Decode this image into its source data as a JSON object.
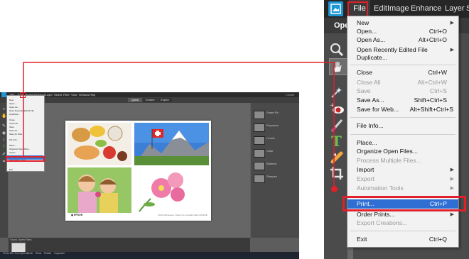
{
  "zoom": {
    "menubar": [
      "File",
      "Edit",
      "Image",
      "Enhance",
      "Layer",
      "S"
    ],
    "open_tab": "Ope",
    "file_menu": {
      "items": [
        {
          "label": "New",
          "shortcut": "",
          "submenu": true,
          "disabled": false
        },
        {
          "label": "Open...",
          "shortcut": "Ctrl+O",
          "submenu": false,
          "disabled": false
        },
        {
          "label": "Open As...",
          "shortcut": "Alt+Ctrl+O",
          "submenu": false,
          "disabled": false
        },
        {
          "label": "Open Recently Edited File",
          "shortcut": "",
          "submenu": true,
          "disabled": false
        },
        {
          "label": "Duplicate...",
          "shortcut": "",
          "submenu": false,
          "disabled": false
        },
        {
          "label": "Close",
          "shortcut": "Ctrl+W",
          "submenu": false,
          "disabled": false
        },
        {
          "label": "Close All",
          "shortcut": "Alt+Ctrl+W",
          "submenu": false,
          "disabled": true
        },
        {
          "label": "Save",
          "shortcut": "Ctrl+S",
          "submenu": false,
          "disabled": true
        },
        {
          "label": "Save As...",
          "shortcut": "Shift+Ctrl+S",
          "submenu": false,
          "disabled": false
        },
        {
          "label": "Save for Web...",
          "shortcut": "Alt+Shift+Ctrl+S",
          "submenu": false,
          "disabled": false
        },
        {
          "label": "File Info...",
          "shortcut": "",
          "submenu": false,
          "disabled": false
        },
        {
          "label": "Place...",
          "shortcut": "",
          "submenu": false,
          "disabled": false
        },
        {
          "label": "Organize Open Files...",
          "shortcut": "",
          "submenu": false,
          "disabled": false
        },
        {
          "label": "Process Multiple Files...",
          "shortcut": "",
          "submenu": false,
          "disabled": true
        },
        {
          "label": "Import",
          "shortcut": "",
          "submenu": true,
          "disabled": false
        },
        {
          "label": "Export",
          "shortcut": "",
          "submenu": true,
          "disabled": true
        },
        {
          "label": "Automation Tools",
          "shortcut": "",
          "submenu": true,
          "disabled": true
        },
        {
          "label": "Print...",
          "shortcut": "Ctrl+P",
          "submenu": false,
          "disabled": false,
          "highlighted": true
        },
        {
          "label": "Order Prints...",
          "shortcut": "",
          "submenu": true,
          "disabled": false
        },
        {
          "label": "Export Creations...",
          "shortcut": "",
          "submenu": false,
          "disabled": true
        },
        {
          "label": "Exit",
          "shortcut": "Ctrl+Q",
          "submenu": false,
          "disabled": false
        }
      ]
    }
  },
  "thumb": {
    "menubar": [
      "File",
      "Edit",
      "Image",
      "Enhance",
      "Layer",
      "Select",
      "Filter",
      "View",
      "Window",
      "Help"
    ],
    "modes": [
      "Quick",
      "Guided",
      "Expert"
    ],
    "create_label": "Create",
    "panel_items": [
      "Smart Fix",
      "Exposure",
      "Levels",
      "Color",
      "Balance",
      "Sharpen"
    ],
    "doc_caption": "Order Rehaugeul. Datent he sopulatic blarit gPdkOE",
    "bin_label": "Show Open Files",
    "bottom_items": [
      "Photo Bin",
      "Tool Options",
      "Undo",
      "Redo",
      "Rotate",
      "Organizer"
    ]
  }
}
